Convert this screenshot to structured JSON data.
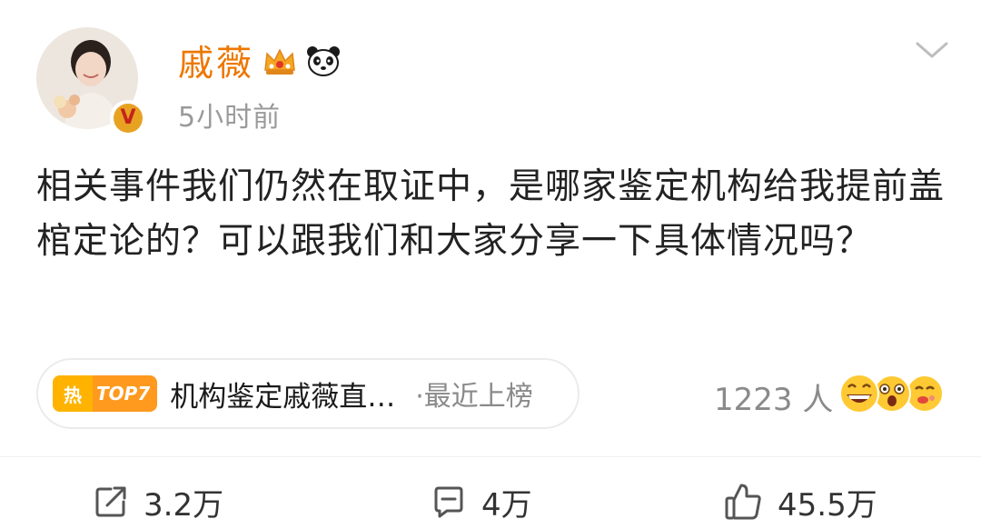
{
  "post": {
    "author_name": "戚薇",
    "time_ago": "5小时前",
    "body": "相关事件我们仍然在取证中，是哪家鉴定机构给我提前盖棺定论的？可以跟我们和大家分享一下具体情况吗？",
    "verified_mark": "V"
  },
  "topic": {
    "hot_flame": "热",
    "hot_rank": "TOP7",
    "title": "机构鉴定戚薇直…",
    "tag": "·最近上榜"
  },
  "reactions": {
    "count": "1223 人",
    "emojis": [
      "grinning-face",
      "astonished-face",
      "kissing-face"
    ]
  },
  "actions": {
    "repost": "3.2万",
    "comment": "4万",
    "like": "45.5万"
  },
  "colors": {
    "author_name": "#ee7700",
    "hot_badge": "#ff9a1f",
    "verified": "#e8a222"
  }
}
